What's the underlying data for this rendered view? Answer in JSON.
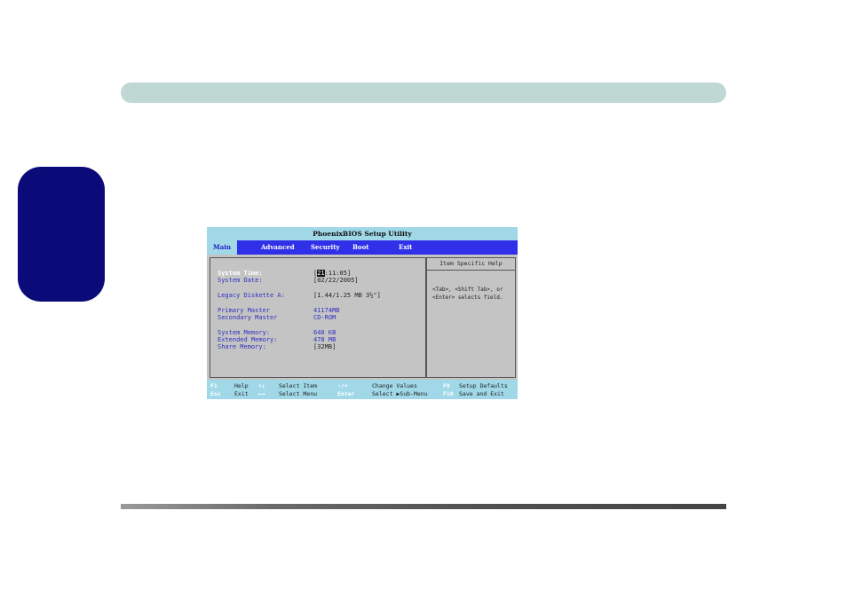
{
  "bios": {
    "title": "PhoenixBIOS Setup Utility",
    "menu": [
      "Main",
      "Advanced",
      "Security",
      "Boot",
      "Exit"
    ],
    "rows": [
      {
        "label": "System Time:",
        "value_prefix": "[",
        "value_highlight": "21",
        "value_suffix": ":11:05]"
      },
      {
        "label": "System Date:",
        "value_prefix": "[",
        "value_suffix": "02/22/2005]"
      },
      {
        "label": "Legacy Diskette A:",
        "value": "[1.44/1.25 MB 3½\"]"
      },
      {
        "label": "Primary Master",
        "value": "41174MB"
      },
      {
        "label": "Secondary Master",
        "value": "CD-ROM"
      },
      {
        "label": "System Memory:",
        "value": "640 KB"
      },
      {
        "label": "Extended Memory:",
        "value": "478 MB"
      },
      {
        "label": "Share Memory:",
        "value": "[32MB]"
      }
    ],
    "help": {
      "title": "Item Specific Help",
      "text": "<Tab>, <Shift Tab>, or <Enter> selects field."
    },
    "keys": {
      "f1": "F1",
      "help": "Help",
      "updown": "↑↓",
      "select_item": "Select Item",
      "minusplus": "-/+",
      "change_values": "Change Values",
      "f9": "F9",
      "setup_defaults": "Setup Defaults",
      "esc": "Esc",
      "exit": "Exit",
      "leftright": "←→",
      "select_menu": "Select Menu",
      "enter": "Enter",
      "select_submenu": "Select ▶Sub-Menu",
      "f10": "F10",
      "save_exit": "Save and Exit"
    }
  }
}
